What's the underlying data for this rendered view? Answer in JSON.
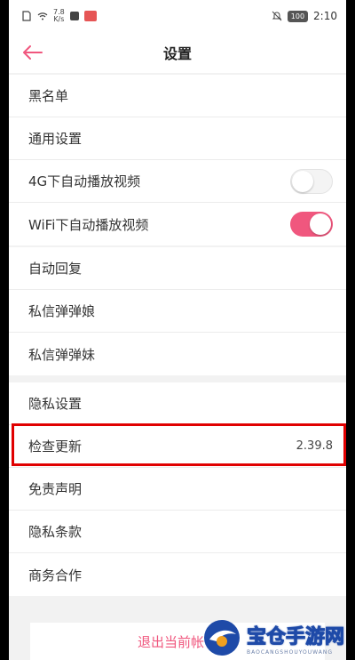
{
  "status_bar": {
    "net_speed": "7.8",
    "net_unit": "K/s",
    "battery": "100",
    "time": "2:10"
  },
  "header": {
    "title": "设置"
  },
  "colors": {
    "accent": "#f0577e",
    "highlight_border": "#e00000"
  },
  "groups": [
    {
      "items": [
        {
          "label": "黑名单"
        },
        {
          "label": "通用设置"
        },
        {
          "label": "4G下自动播放视频",
          "toggle": "off"
        },
        {
          "label": "WiFi下自动播放视频",
          "toggle": "on"
        }
      ]
    },
    {
      "items": [
        {
          "label": "自动回复"
        },
        {
          "label": "私信弹弹娘"
        },
        {
          "label": "私信弹弹妹"
        }
      ]
    },
    {
      "items": [
        {
          "label": "隐私设置"
        },
        {
          "label": "检查更新",
          "value": "2.39.8"
        },
        {
          "label": "免责声明"
        },
        {
          "label": "隐私条款"
        },
        {
          "label": "商务合作"
        }
      ]
    }
  ],
  "logout_label": "退出当前帐号",
  "watermark": {
    "name": "宝仓手游网",
    "sub": "BAOCANGSHOUYOUWANG"
  }
}
